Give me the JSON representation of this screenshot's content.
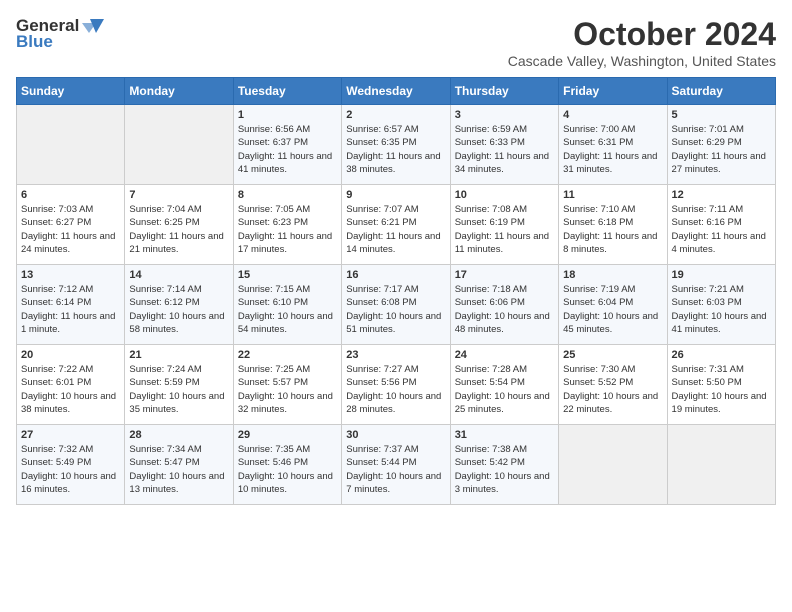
{
  "header": {
    "logo_general": "General",
    "logo_blue": "Blue",
    "month": "October 2024",
    "location": "Cascade Valley, Washington, United States"
  },
  "days_of_week": [
    "Sunday",
    "Monday",
    "Tuesday",
    "Wednesday",
    "Thursday",
    "Friday",
    "Saturday"
  ],
  "weeks": [
    [
      {
        "day": "",
        "content": ""
      },
      {
        "day": "",
        "content": ""
      },
      {
        "day": "1",
        "content": "Sunrise: 6:56 AM\nSunset: 6:37 PM\nDaylight: 11 hours and 41 minutes."
      },
      {
        "day": "2",
        "content": "Sunrise: 6:57 AM\nSunset: 6:35 PM\nDaylight: 11 hours and 38 minutes."
      },
      {
        "day": "3",
        "content": "Sunrise: 6:59 AM\nSunset: 6:33 PM\nDaylight: 11 hours and 34 minutes."
      },
      {
        "day": "4",
        "content": "Sunrise: 7:00 AM\nSunset: 6:31 PM\nDaylight: 11 hours and 31 minutes."
      },
      {
        "day": "5",
        "content": "Sunrise: 7:01 AM\nSunset: 6:29 PM\nDaylight: 11 hours and 27 minutes."
      }
    ],
    [
      {
        "day": "6",
        "content": "Sunrise: 7:03 AM\nSunset: 6:27 PM\nDaylight: 11 hours and 24 minutes."
      },
      {
        "day": "7",
        "content": "Sunrise: 7:04 AM\nSunset: 6:25 PM\nDaylight: 11 hours and 21 minutes."
      },
      {
        "day": "8",
        "content": "Sunrise: 7:05 AM\nSunset: 6:23 PM\nDaylight: 11 hours and 17 minutes."
      },
      {
        "day": "9",
        "content": "Sunrise: 7:07 AM\nSunset: 6:21 PM\nDaylight: 11 hours and 14 minutes."
      },
      {
        "day": "10",
        "content": "Sunrise: 7:08 AM\nSunset: 6:19 PM\nDaylight: 11 hours and 11 minutes."
      },
      {
        "day": "11",
        "content": "Sunrise: 7:10 AM\nSunset: 6:18 PM\nDaylight: 11 hours and 8 minutes."
      },
      {
        "day": "12",
        "content": "Sunrise: 7:11 AM\nSunset: 6:16 PM\nDaylight: 11 hours and 4 minutes."
      }
    ],
    [
      {
        "day": "13",
        "content": "Sunrise: 7:12 AM\nSunset: 6:14 PM\nDaylight: 11 hours and 1 minute."
      },
      {
        "day": "14",
        "content": "Sunrise: 7:14 AM\nSunset: 6:12 PM\nDaylight: 10 hours and 58 minutes."
      },
      {
        "day": "15",
        "content": "Sunrise: 7:15 AM\nSunset: 6:10 PM\nDaylight: 10 hours and 54 minutes."
      },
      {
        "day": "16",
        "content": "Sunrise: 7:17 AM\nSunset: 6:08 PM\nDaylight: 10 hours and 51 minutes."
      },
      {
        "day": "17",
        "content": "Sunrise: 7:18 AM\nSunset: 6:06 PM\nDaylight: 10 hours and 48 minutes."
      },
      {
        "day": "18",
        "content": "Sunrise: 7:19 AM\nSunset: 6:04 PM\nDaylight: 10 hours and 45 minutes."
      },
      {
        "day": "19",
        "content": "Sunrise: 7:21 AM\nSunset: 6:03 PM\nDaylight: 10 hours and 41 minutes."
      }
    ],
    [
      {
        "day": "20",
        "content": "Sunrise: 7:22 AM\nSunset: 6:01 PM\nDaylight: 10 hours and 38 minutes."
      },
      {
        "day": "21",
        "content": "Sunrise: 7:24 AM\nSunset: 5:59 PM\nDaylight: 10 hours and 35 minutes."
      },
      {
        "day": "22",
        "content": "Sunrise: 7:25 AM\nSunset: 5:57 PM\nDaylight: 10 hours and 32 minutes."
      },
      {
        "day": "23",
        "content": "Sunrise: 7:27 AM\nSunset: 5:56 PM\nDaylight: 10 hours and 28 minutes."
      },
      {
        "day": "24",
        "content": "Sunrise: 7:28 AM\nSunset: 5:54 PM\nDaylight: 10 hours and 25 minutes."
      },
      {
        "day": "25",
        "content": "Sunrise: 7:30 AM\nSunset: 5:52 PM\nDaylight: 10 hours and 22 minutes."
      },
      {
        "day": "26",
        "content": "Sunrise: 7:31 AM\nSunset: 5:50 PM\nDaylight: 10 hours and 19 minutes."
      }
    ],
    [
      {
        "day": "27",
        "content": "Sunrise: 7:32 AM\nSunset: 5:49 PM\nDaylight: 10 hours and 16 minutes."
      },
      {
        "day": "28",
        "content": "Sunrise: 7:34 AM\nSunset: 5:47 PM\nDaylight: 10 hours and 13 minutes."
      },
      {
        "day": "29",
        "content": "Sunrise: 7:35 AM\nSunset: 5:46 PM\nDaylight: 10 hours and 10 minutes."
      },
      {
        "day": "30",
        "content": "Sunrise: 7:37 AM\nSunset: 5:44 PM\nDaylight: 10 hours and 7 minutes."
      },
      {
        "day": "31",
        "content": "Sunrise: 7:38 AM\nSunset: 5:42 PM\nDaylight: 10 hours and 3 minutes."
      },
      {
        "day": "",
        "content": ""
      },
      {
        "day": "",
        "content": ""
      }
    ]
  ]
}
